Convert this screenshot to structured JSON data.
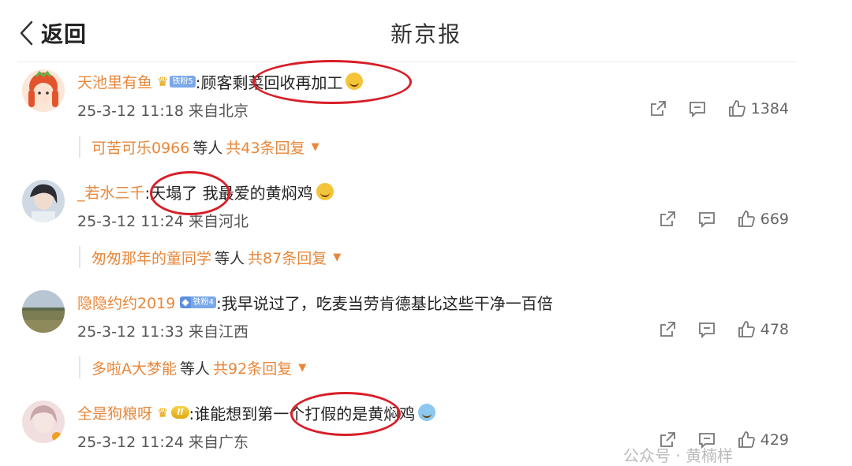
{
  "header": {
    "back_label": "返回",
    "title": "新京报"
  },
  "comments": [
    {
      "username": "天池里有鱼",
      "badge_text": "铁粉5",
      "text_before": ":顾客",
      "text_highlight": "剩菜回收再加工",
      "time": "25-3-12 11:18",
      "location": "来自北京",
      "likes": "1384",
      "reply_user": "可苦可乐0966",
      "reply_mid": "等人",
      "reply_count": "共43条回复"
    },
    {
      "username": "_若水三千",
      "text_before": ":",
      "text_highlight": "天塌了",
      "text_after": " 我最爱的黄焖鸡",
      "time": "25-3-12 11:24",
      "location": "来自河北",
      "likes": "669",
      "reply_user": "匆匆那年的童同学",
      "reply_mid": "等人",
      "reply_count": "共87条回复"
    },
    {
      "username": "隐隐约约2019",
      "badge_text": "铁粉4",
      "text_before": ":我早说过了，吃麦当劳肯德基比这些干净一百倍",
      "time": "25-3-12 11:33",
      "location": "来自江西",
      "likes": "478",
      "reply_user": "多啦A大梦能",
      "reply_mid": "等人",
      "reply_count": "共92条回复"
    },
    {
      "username": "全是狗粮呀",
      "badge_text": "II",
      "text_before": ":谁能想到",
      "text_highlight": "第一个打假的",
      "text_after": "是黄焖鸡",
      "time": "25-3-12 11:24",
      "location": "来自广东",
      "likes": "429"
    }
  ],
  "watermark": "公众号 · 黄楠样",
  "colors": {
    "username": "#e8873a",
    "highlight_circle": "#d81e28",
    "badge_blue": "#7aa8e8",
    "badge_gold": "#e0a712"
  }
}
